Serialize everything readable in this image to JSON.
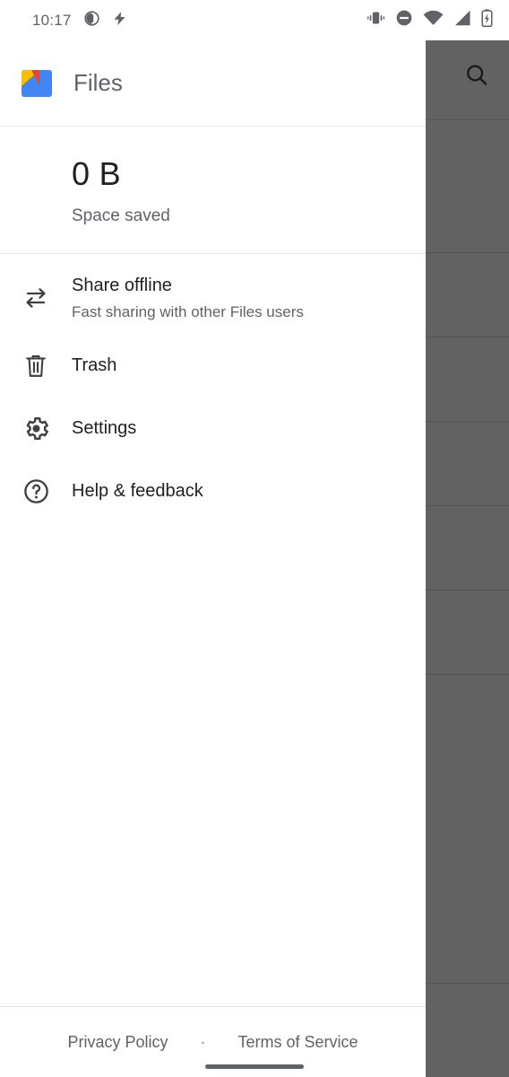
{
  "status_bar": {
    "time": "10:17",
    "icons": [
      {
        "name": "screenshot-icon",
        "glyph": "◐"
      },
      {
        "name": "flash-icon",
        "glyph": "⚡"
      }
    ],
    "right_icons": [
      {
        "name": "vibrate-icon"
      },
      {
        "name": "do-not-disturb-icon"
      },
      {
        "name": "wifi-icon"
      },
      {
        "name": "cell-signal-icon"
      },
      {
        "name": "battery-charging-icon"
      }
    ]
  },
  "drawer": {
    "header": {
      "app_name": "Files",
      "logo_name": "files-app-logo",
      "logo_colors": {
        "base": "#4285F4",
        "green": "#34A853",
        "yellow": "#FBBC04",
        "red": "#EA4335"
      }
    },
    "storage": {
      "value": "0 B",
      "label": "Space saved"
    },
    "items": [
      {
        "id": "share-offline",
        "icon": "swap-arrows-icon",
        "title": "Share offline",
        "subtitle": "Fast sharing with other Files users"
      },
      {
        "id": "trash",
        "icon": "trash-icon",
        "title": "Trash",
        "subtitle": ""
      },
      {
        "id": "settings",
        "icon": "gear-icon",
        "title": "Settings",
        "subtitle": ""
      },
      {
        "id": "help-feedback",
        "icon": "help-circle-icon",
        "title": "Help & feedback",
        "subtitle": ""
      }
    ],
    "footer": {
      "privacy": "Privacy Policy",
      "separator": "·",
      "terms": "Terms of Service"
    }
  },
  "background_screen": {
    "search_icon": "search-icon",
    "scrim_color": "#626262"
  }
}
